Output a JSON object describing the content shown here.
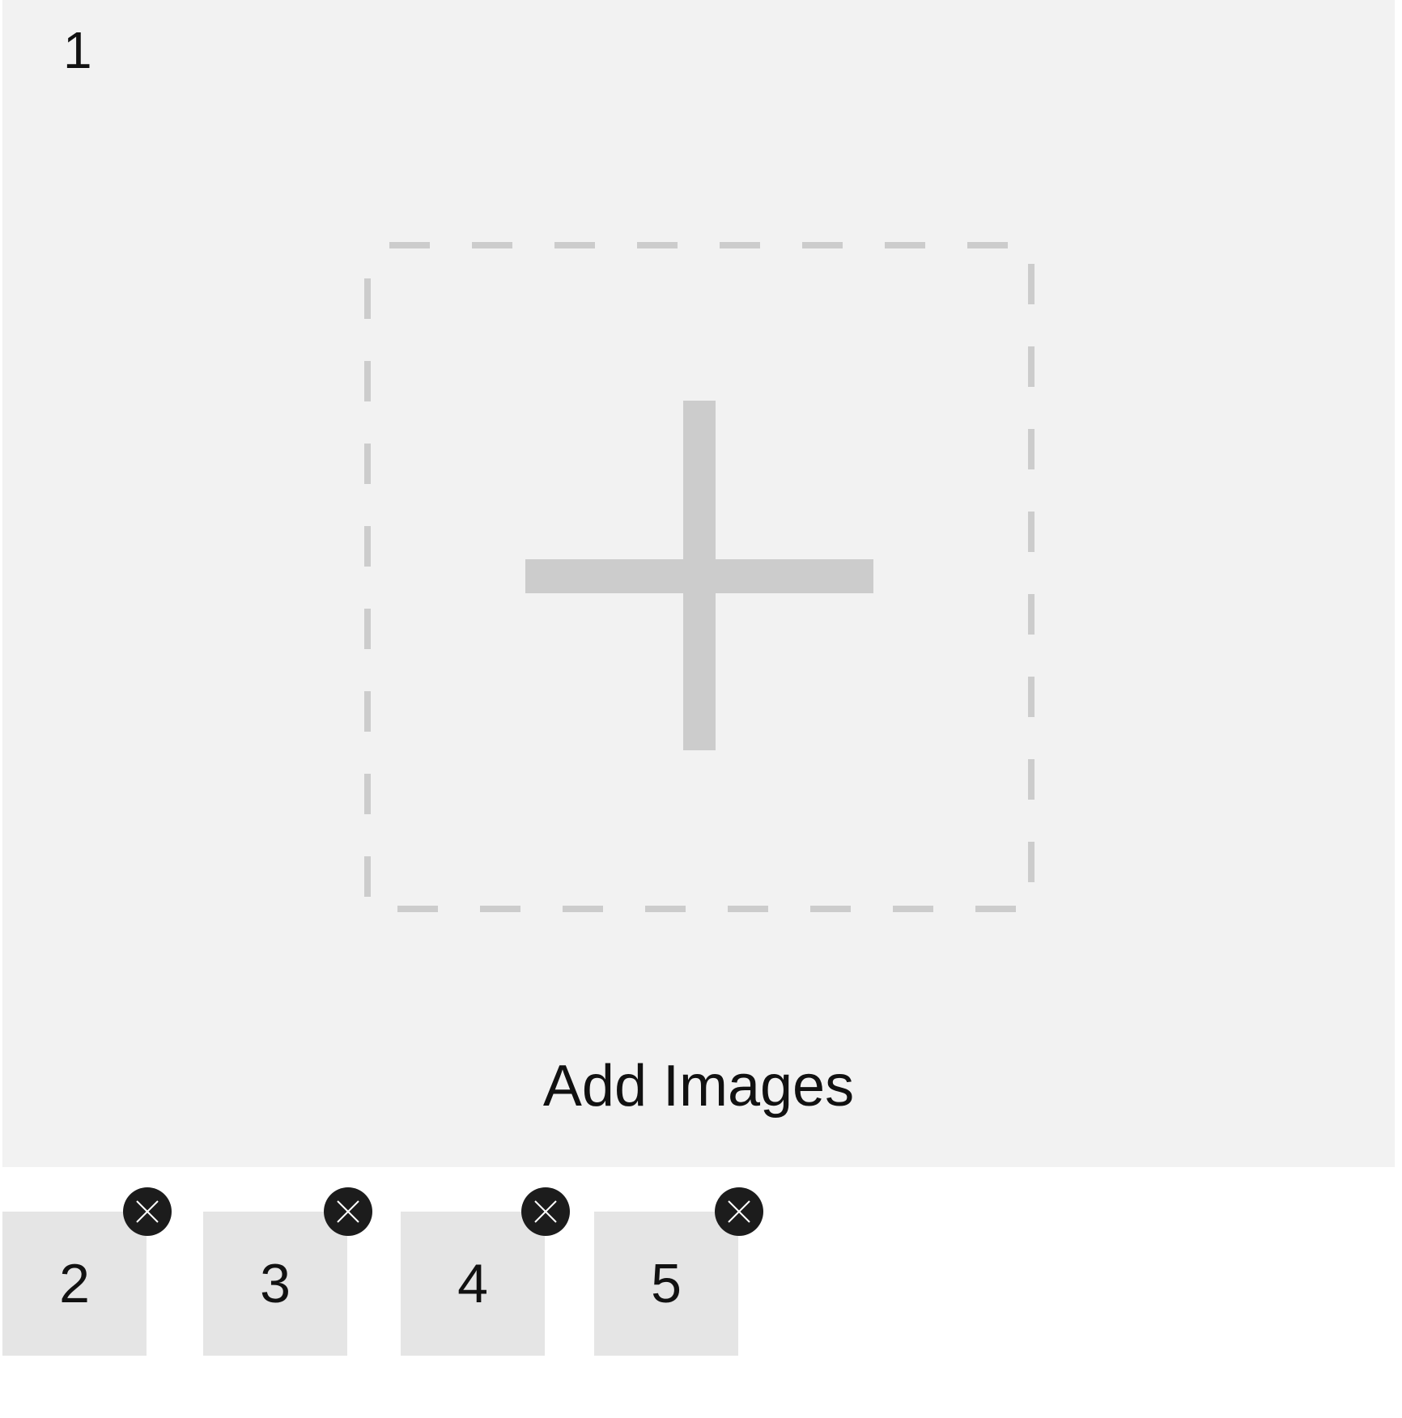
{
  "main_slot": {
    "number": "1",
    "add_label": "Add Images",
    "icon": "plus-icon"
  },
  "thumbnails": [
    {
      "number": "2",
      "remove_icon": "close-icon"
    },
    {
      "number": "3",
      "remove_icon": "close-icon"
    },
    {
      "number": "4",
      "remove_icon": "close-icon"
    },
    {
      "number": "5",
      "remove_icon": "close-icon"
    }
  ],
  "colors": {
    "panel_background": "#f2f2f2",
    "thumbnail_background": "#e5e5e5",
    "placeholder_stroke": "#cccccc",
    "remove_button": "#1c1c1c",
    "text": "#111111"
  }
}
